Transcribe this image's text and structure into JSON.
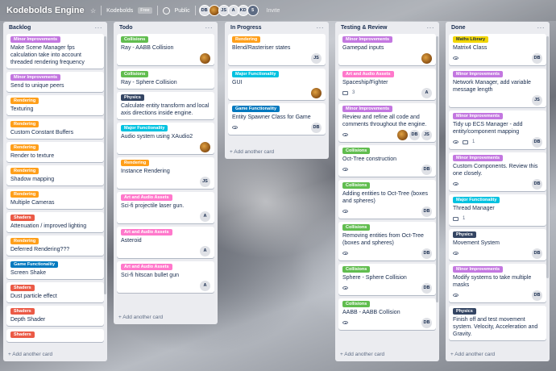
{
  "header": {
    "board_title": "Kodebolds Engine",
    "workspace": "Kodebolds",
    "plan": "Free",
    "visibility": "Public",
    "members": [
      {
        "initials": "DB",
        "style": "plain"
      },
      {
        "initials": "",
        "style": "photo"
      },
      {
        "initials": "JS",
        "style": "plain"
      },
      {
        "initials": "A",
        "style": "plain"
      },
      {
        "initials": "KD",
        "style": "plain"
      },
      {
        "initials": "5",
        "style": "dark"
      }
    ],
    "invite": "Invite"
  },
  "colors": {
    "Minor Improvements": "#c377e0",
    "Collisions": "#61bd4f",
    "Rendering": "#ff9f1a",
    "Physics": "#344563",
    "Major Functionality": "#00c2e0",
    "Art and Audio Assets": "#ff78cb",
    "Game Functionality": "#0079bf",
    "Shaders": "#eb5a46",
    "Maths Library": "#f2d600"
  },
  "add_card_label": "+ Add another card",
  "lists": [
    {
      "title": "Backlog",
      "cards": [
        {
          "label": "Minor Improvements",
          "title": "Make Scene Manager fps calculation take into account threaded rendering frequency"
        },
        {
          "label": "Minor Improvements",
          "title": "Send to unique peers"
        },
        {
          "label": "Rendering",
          "title": "Texturing"
        },
        {
          "label": "Rendering",
          "title": "Custom Constant Buffers"
        },
        {
          "label": "Rendering",
          "title": "Render to texture"
        },
        {
          "label": "Rendering",
          "title": "Shadow mapping"
        },
        {
          "label": "Rendering",
          "title": "Multiple Cameras"
        },
        {
          "label": "Shaders",
          "title": "Attenuation / improved lighting"
        },
        {
          "label": "Rendering",
          "title": "Deferred Rendering???"
        },
        {
          "label": "Game Functionality",
          "title": "Screen Shake"
        },
        {
          "label": "Shaders",
          "title": "Dust particle effect"
        },
        {
          "label": "Shaders",
          "title": "Depth Shader"
        },
        {
          "label": "Shaders",
          "title": ""
        }
      ]
    },
    {
      "title": "Todo",
      "cards": [
        {
          "label": "Collisions",
          "title": "Ray - AABB Collision",
          "avatar": "photo"
        },
        {
          "label": "Collisions",
          "title": "Ray - Sphere Collision"
        },
        {
          "label": "Physics",
          "title": "Calculate entity transform and local axis directions inside engine."
        },
        {
          "label": "Major Functionality",
          "title": "Audio system using XAudio2",
          "avatar": "photo"
        },
        {
          "label": "Rendering",
          "title": "Instance Rendering",
          "avatar": "JS"
        },
        {
          "label": "Art and Audio Assets",
          "title": "Sci-fi projectile laser gun.",
          "avatar": "A"
        },
        {
          "label": "Art and Audio Assets",
          "title": "Asteroid",
          "avatar": "A"
        },
        {
          "label": "Art and Audio Assets",
          "title": "Sci-fi hitscan bullet gun",
          "avatar": "A"
        }
      ]
    },
    {
      "title": "In Progress",
      "cards": [
        {
          "label": "Rendering",
          "title": "Blend/Rasteriser states",
          "avatar": "JS"
        },
        {
          "label": "Major Functionality",
          "title": "GUI",
          "avatar": "photo"
        },
        {
          "label": "Game Functionality",
          "title": "Entity Spawner Class for Game",
          "watch": true,
          "avatar": "DB"
        }
      ]
    },
    {
      "title": "Testing & Review",
      "cards": [
        {
          "label": "Minor Improvements",
          "title": "Gamepad inputs",
          "avatar": "photo"
        },
        {
          "label": "Art and Audio Assets",
          "title": "Spaceship/Fighter",
          "checklist": "3",
          "avatar": "A"
        },
        {
          "label": "Minor Improvements",
          "title": "Review and refine all code and comments throughout the engine.",
          "watch": true,
          "avatar": "photo",
          "avatars_extra": [
            "DB",
            "JS"
          ]
        },
        {
          "label": "Collisions",
          "title": "Oct-Tree construction",
          "watch": true,
          "avatar": "DB"
        },
        {
          "label": "Collisions",
          "title": "Adding entities to Oct-Tree (boxes and spheres)",
          "watch": true,
          "avatar": "DB"
        },
        {
          "label": "Collisions",
          "title": "Removing entities from Oct-Tree (boxes and spheres)",
          "watch": true,
          "avatar": "DB"
        },
        {
          "label": "Collisions",
          "title": "Sphere - Sphere Collision",
          "watch": true,
          "avatar": "DB"
        },
        {
          "label": "Collisions",
          "title": "AABB - AABB Collision",
          "watch": true,
          "avatar": "DB"
        }
      ]
    },
    {
      "title": "Done",
      "cards": [
        {
          "label": "Maths Library",
          "title": "Matrix4 Class",
          "watch": true,
          "avatar": "DB"
        },
        {
          "label": "Minor Improvements",
          "title": "Network Manager, add variable message length",
          "avatar": "JS"
        },
        {
          "label": "Minor Improvements",
          "title": "Tidy up ECS Manager - add entity/component mapping",
          "watch": true,
          "comments": "1",
          "avatar": "DB"
        },
        {
          "label": "Minor Improvements",
          "title": "Custom Components. Review this one closely.",
          "watch": true,
          "avatar": "DB"
        },
        {
          "label": "Major Functionality",
          "title": "Thread Manager",
          "comments": "1"
        },
        {
          "label": "Physics",
          "title": "Movement System",
          "watch": true,
          "avatar": "DB"
        },
        {
          "label": "Minor Improvements",
          "title": "Modify systems to take multiple masks",
          "watch": true,
          "avatar": "DB"
        },
        {
          "label": "Physics",
          "title": "Finish off and test movement system. Velocity, Acceleration and Gravity."
        }
      ]
    }
  ]
}
